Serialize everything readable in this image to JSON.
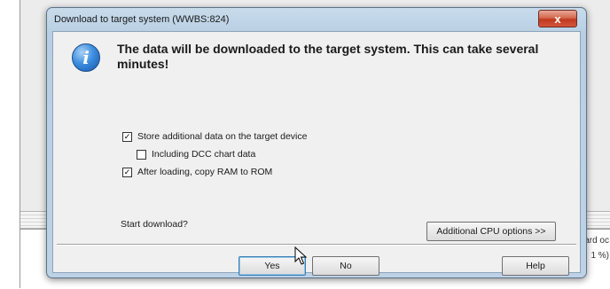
{
  "background": {
    "right_text_1": "ard oc",
    "right_text_2": "1 %)"
  },
  "dialog": {
    "title": "Download to target system (WWBS:824)",
    "close_glyph": "x",
    "icon": "info-icon",
    "message": "The data will be downloaded to the target system. This can take several minutes!",
    "options": [
      {
        "label": "Store additional data on the target device",
        "checked": true
      },
      {
        "label": "Including DCC chart data",
        "checked": false
      },
      {
        "label": "After loading, copy RAM to ROM",
        "checked": true
      }
    ],
    "prompt": "Start download?",
    "cpu_options_label": "Additional CPU options >>",
    "buttons": {
      "yes": "Yes",
      "no": "No",
      "help": "Help"
    }
  }
}
